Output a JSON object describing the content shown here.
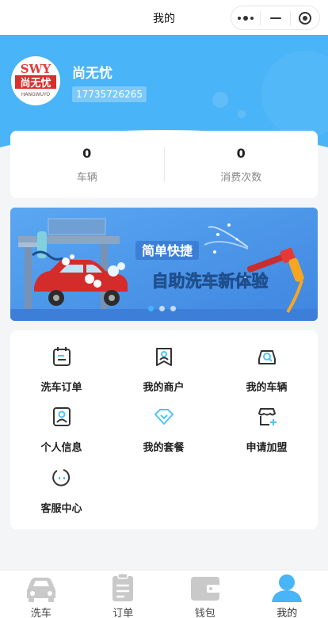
{
  "titlebar": {
    "title": "我的"
  },
  "profile": {
    "name": "尚无忧",
    "phone": "17735726265",
    "logo_text": "SWY",
    "logo_cn": "尚无忧",
    "logo_sub": "HANGWUYO"
  },
  "stats": [
    {
      "value": "0",
      "label": "车辆"
    },
    {
      "value": "0",
      "label": "消费次数"
    }
  ],
  "banner": {
    "headline_small": "简单快捷",
    "headline_big": "自助洗车新体验",
    "slides": 3,
    "active_slide": 1
  },
  "menu": [
    {
      "label": "洗车订单",
      "icon": "order-list-icon"
    },
    {
      "label": "我的商户",
      "icon": "merchant-icon"
    },
    {
      "label": "我的车辆",
      "icon": "car-search-icon"
    },
    {
      "label": "个人信息",
      "icon": "profile-card-icon"
    },
    {
      "label": "我的套餐",
      "icon": "package-diamond-icon"
    },
    {
      "label": "申请加盟",
      "icon": "store-add-icon"
    },
    {
      "label": "客服中心",
      "icon": "service-chat-icon"
    }
  ],
  "tabbar": [
    {
      "label": "洗车",
      "icon": "car-wash-icon",
      "active": false
    },
    {
      "label": "订单",
      "icon": "clipboard-icon",
      "active": false
    },
    {
      "label": "钱包",
      "icon": "wallet-icon",
      "active": false
    },
    {
      "label": "我的",
      "icon": "user-icon",
      "active": true
    }
  ],
  "colors": {
    "accent": "#49b4f7",
    "icon_dark": "#333333",
    "icon_accent": "#4fc3f7",
    "tab_inactive": "#c9c9c9"
  }
}
